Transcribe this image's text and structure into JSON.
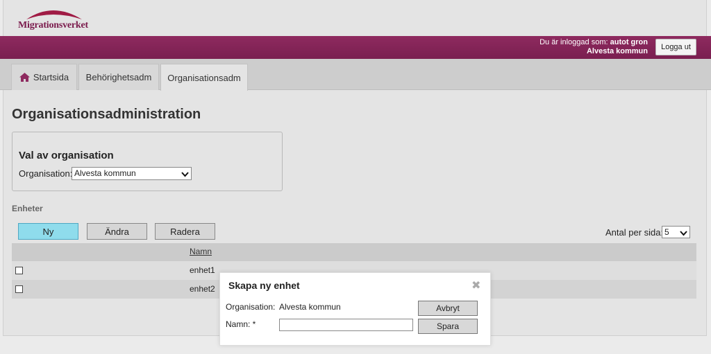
{
  "header": {
    "logo_text": "Migrationsverket",
    "login_label": "Du är inloggad som:",
    "login_user": "autot gron",
    "login_org": "Alvesta kommun",
    "logout_label": "Logga ut"
  },
  "tabs": [
    {
      "label": "Startsida",
      "icon": "home-icon"
    },
    {
      "label": "Behörighetsadm"
    },
    {
      "label": "Organisationsadm",
      "active": true
    }
  ],
  "main": {
    "title": "Organisationsadministration",
    "org_section": {
      "title": "Val av organisation",
      "label": "Organisation:",
      "selected": "Alvesta kommun"
    },
    "units_label": "Enheter",
    "buttons": {
      "new": "Ny",
      "edit": "Ändra",
      "delete": "Radera"
    },
    "per_page_label": "Antal per sida:",
    "per_page_value": "5",
    "table": {
      "columns": [
        "Namn"
      ],
      "rows": [
        {
          "name": "enhet1"
        },
        {
          "name": "enhet2"
        }
      ]
    }
  },
  "modal": {
    "title": "Skapa ny enhet",
    "org_label": "Organisation:",
    "org_value": "Alvesta kommun",
    "name_label": "Namn: *",
    "name_value": "",
    "cancel_label": "Avbryt",
    "save_label": "Spara"
  },
  "colors": {
    "brand": "#7a1f50",
    "primary_button": "#8fdcec"
  }
}
